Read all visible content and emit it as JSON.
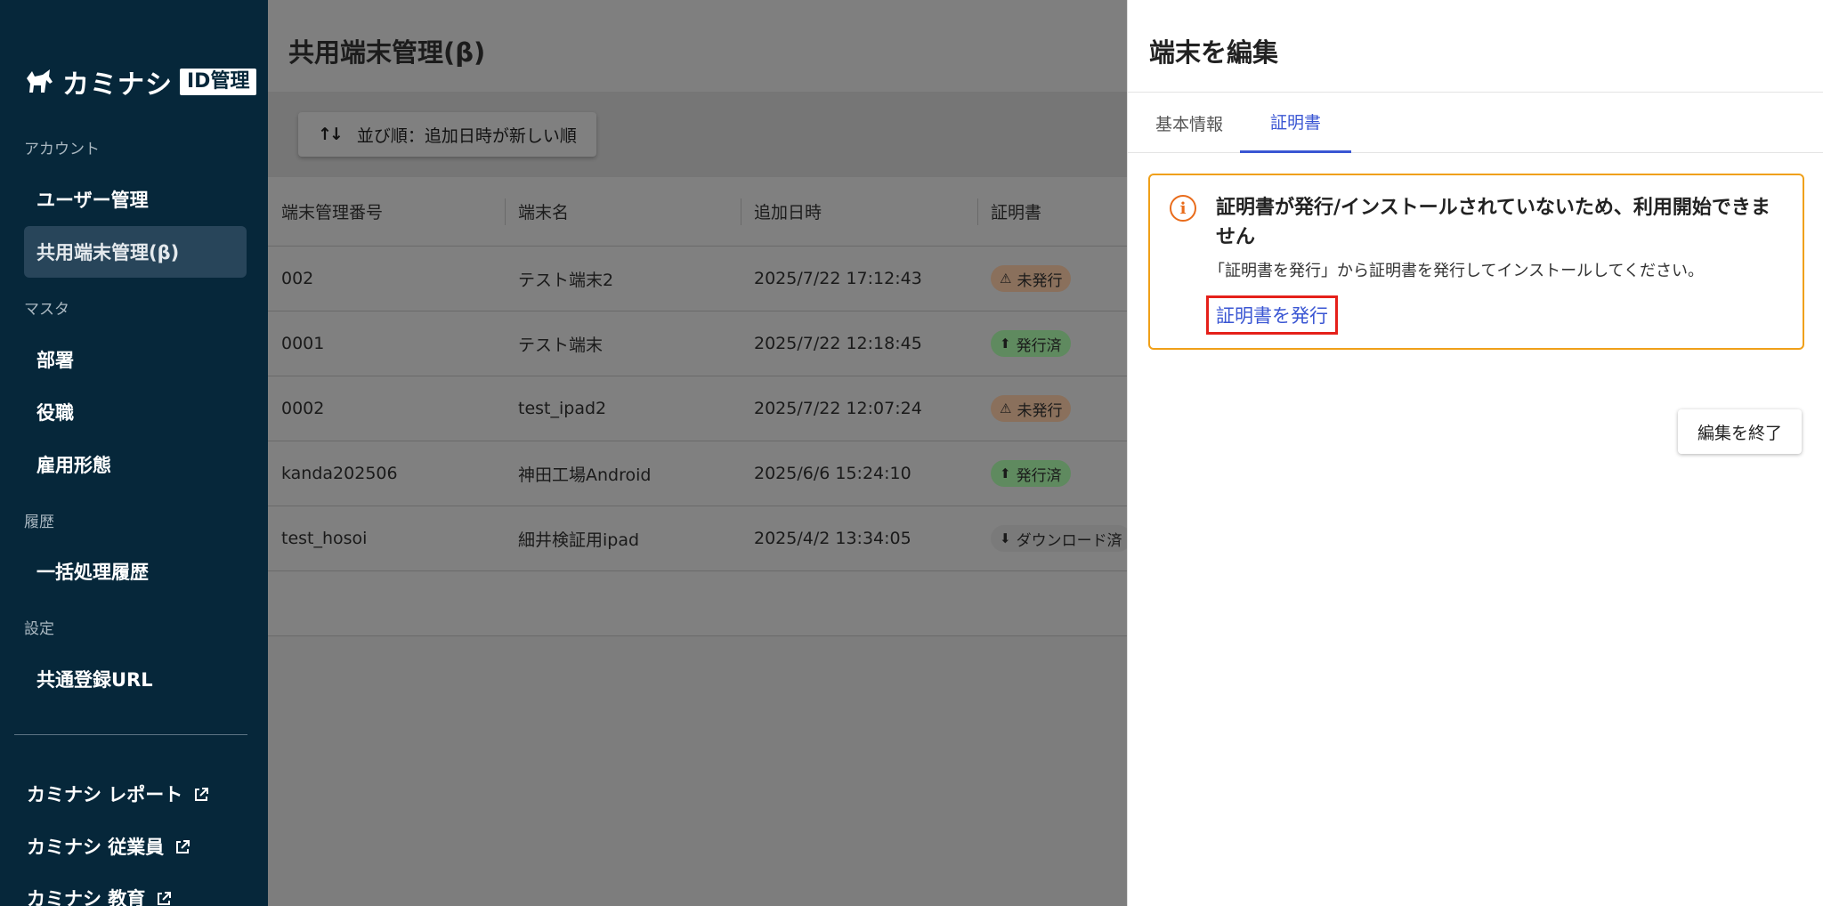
{
  "sidebar": {
    "logo_text": "カミナシ",
    "logo_badge": "ID管理",
    "sections": {
      "account": "アカウント",
      "master": "マスタ",
      "history": "履歴",
      "settings": "設定"
    },
    "items": {
      "users": "ユーザー管理",
      "shared_devices": "共用端末管理(β)",
      "departments": "部署",
      "positions": "役職",
      "employment": "雇用形態",
      "batch_history": "一括処理履歴",
      "common_url": "共通登録URL"
    },
    "external_links": [
      "カミナシ レポート",
      "カミナシ 従業員",
      "カミナシ 教育"
    ]
  },
  "main": {
    "title": "共用端末管理(β)",
    "sort_label": "並び順：追加日時が新しい順",
    "columns": [
      "端末管理番号",
      "端末名",
      "追加日時",
      "証明書"
    ],
    "rows": [
      {
        "id": "002",
        "name": "テスト端末2",
        "added": "2025/7/22 17:12:43",
        "cert": "未発行",
        "cert_status": "warning"
      },
      {
        "id": "0001",
        "name": "テスト端末",
        "added": "2025/7/22 12:18:45",
        "cert": "発行済",
        "cert_status": "issued"
      },
      {
        "id": "0002",
        "name": "test_ipad2",
        "added": "2025/7/22 12:07:24",
        "cert": "未発行",
        "cert_status": "warning"
      },
      {
        "id": "kanda202506",
        "name": "神田工場Android",
        "added": "2025/6/6 15:24:10",
        "cert": "発行済",
        "cert_status": "issued"
      },
      {
        "id": "test_hosoi",
        "name": "細井検証用ipad",
        "added": "2025/4/2 13:34:05",
        "cert": "ダウンロード済",
        "cert_status": "downloaded"
      }
    ]
  },
  "drawer": {
    "title": "端末を編集",
    "tabs": [
      "基本情報",
      "証明書"
    ],
    "active_tab": "証明書",
    "alert": {
      "title": "証明書が発行/インストールされていないため、利用開始できません",
      "body": "「証明書を発行」から証明書を発行してインストールしてください。",
      "link": "証明書を発行"
    },
    "finish_button": "編集を終了"
  },
  "colors": {
    "sidebar_bg": "#06273a",
    "accent": "#3a56d3",
    "alert_border": "#f0a019",
    "alert_icon": "#e96c1b",
    "highlight": "#e5201a"
  }
}
